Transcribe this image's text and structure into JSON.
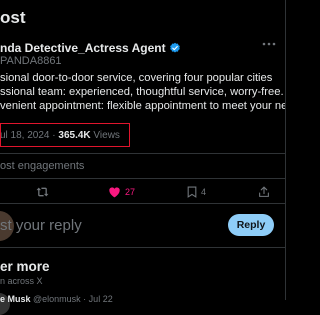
{
  "header": {
    "title": "ost"
  },
  "tweet": {
    "author_name": "nda Detective_Actress Agent",
    "author_handle": "PANDA8861",
    "text_lines": [
      "sional door-to-door service, covering four popular cities",
      "ssional team: experienced, thoughtful service, worry-free.",
      "venient appointment: flexible appointment to meet your needs"
    ],
    "date": "ul 18, 2024",
    "separator": " · ",
    "views_count": "365.4K",
    "views_label": "Views",
    "engagements_label": "ost engagements"
  },
  "actions": {
    "like_count": "27",
    "bookmark_count": "4"
  },
  "reply": {
    "placeholder": "st your reply",
    "button_label": "Reply"
  },
  "discover": {
    "title": "er more",
    "subtitle": "n across X",
    "next_post_author": "e Musk",
    "next_post_handle": "@elonmusk · Jul 22"
  },
  "colors": {
    "background": "#000000",
    "verified": "#1d9bf0",
    "like_active": "#f91880",
    "highlight_box": "#e0152d",
    "reply_button": "#8ecdf8"
  },
  "icons": [
    "verified-badge-icon",
    "more-icon",
    "retweet-icon",
    "heart-icon",
    "bookmark-icon",
    "share-icon"
  ]
}
